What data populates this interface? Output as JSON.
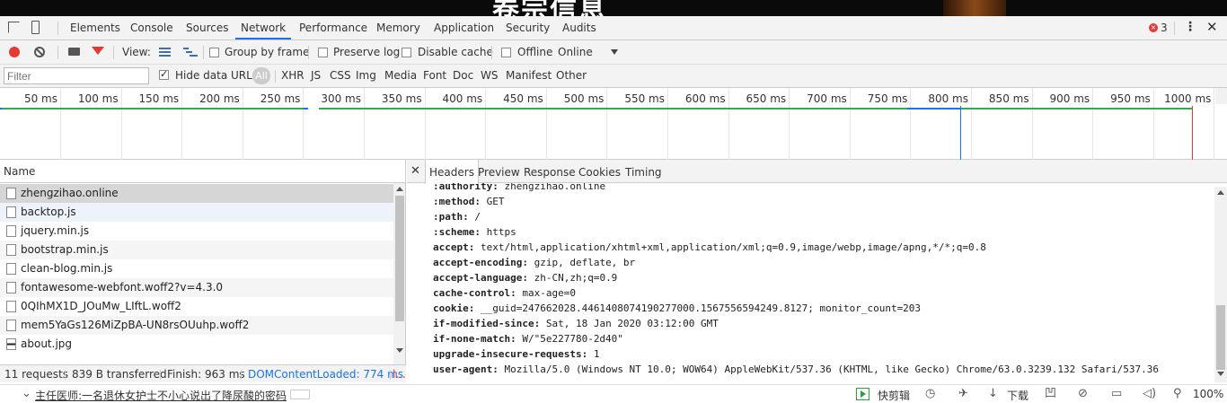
{
  "devtools": {
    "tabs": [
      "Elements",
      "Console",
      "Sources",
      "Network",
      "Performance",
      "Memory",
      "Application",
      "Security",
      "Audits"
    ],
    "active_tab": "Network",
    "error_count": "3"
  },
  "toolbar": {
    "view_label": "View:",
    "group_by_frame": "Group by frame",
    "preserve_log": "Preserve log",
    "disable_cache": "Disable cache",
    "offline": "Offline",
    "throttle": "Online"
  },
  "filterbar": {
    "filter_placeholder": "Filter",
    "hide_data_urls": "Hide data URLs",
    "types": [
      "All",
      "XHR",
      "JS",
      "CSS",
      "Img",
      "Media",
      "Font",
      "Doc",
      "WS",
      "Manifest",
      "Other"
    ]
  },
  "timeline": {
    "ticks": [
      "50 ms",
      "100 ms",
      "150 ms",
      "200 ms",
      "250 ms",
      "300 ms",
      "350 ms",
      "400 ms",
      "450 ms",
      "500 ms",
      "550 ms",
      "600 ms",
      "650 ms",
      "700 ms",
      "750 ms",
      "800 ms",
      "850 ms",
      "900 ms",
      "950 ms",
      "1000 ms"
    ],
    "colors": {
      "dom_content_loaded": "#1a73e8",
      "load": "#e53935",
      "waterfall": "#34a853"
    }
  },
  "requests": {
    "header": "Name",
    "items": [
      {
        "name": "zhengzihao.online",
        "type": "doc"
      },
      {
        "name": "backtop.js",
        "type": "doc"
      },
      {
        "name": "jquery.min.js",
        "type": "doc"
      },
      {
        "name": "bootstrap.min.js",
        "type": "doc"
      },
      {
        "name": "clean-blog.min.js",
        "type": "doc"
      },
      {
        "name": "fontawesome-webfont.woff2?v=4.3.0",
        "type": "doc"
      },
      {
        "name": "0QIhMX1D_JOuMw_LIftL.woff2",
        "type": "doc"
      },
      {
        "name": "mem5YaGs126MiZpBA-UN8rsOUuhp.woff2",
        "type": "doc"
      },
      {
        "name": "about.jpg",
        "type": "img"
      }
    ]
  },
  "status": {
    "requests": "11 requests",
    "transferred": "839 B transferred",
    "finish": "Finish: 963 ms",
    "dcl": "DOMContentLoaded: 774 ms",
    "load": "l..."
  },
  "details": {
    "tabs": [
      "Headers",
      "Preview",
      "Response",
      "Cookies",
      "Timing"
    ],
    "active_tab": "Headers",
    "headers": [
      {
        "key": ":authority:",
        "value": "zhengzihao.online"
      },
      {
        "key": ":method:",
        "value": "GET"
      },
      {
        "key": ":path:",
        "value": "/"
      },
      {
        "key": ":scheme:",
        "value": "https"
      },
      {
        "key": "accept:",
        "value": "text/html,application/xhtml+xml,application/xml;q=0.9,image/webp,image/apng,*/*;q=0.8"
      },
      {
        "key": "accept-encoding:",
        "value": "gzip, deflate, br"
      },
      {
        "key": "accept-language:",
        "value": "zh-CN,zh;q=0.9"
      },
      {
        "key": "cache-control:",
        "value": "max-age=0"
      },
      {
        "key": "cookie:",
        "value": "__guid=247662028.4461408074190277000.1567556594249.8127; monitor_count=203"
      },
      {
        "key": "if-modified-since:",
        "value": "Sat, 18 Jan 2020 03:12:00 GMT"
      },
      {
        "key": "if-none-match:",
        "value": "W/\"5e227780-2d40\""
      },
      {
        "key": "upgrade-insecure-requests:",
        "value": "1"
      },
      {
        "key": "user-agent:",
        "value": "Mozilla/5.0 (Windows NT 10.0; WOW64) AppleWebKit/537.36 (KHTML, like Gecko) Chrome/63.0.3239.132 Safari/537.36"
      }
    ]
  },
  "browser_bar": {
    "news": "主任医师:一名退休女护士不小心说出了降尿酸的密码",
    "cut": "快剪辑",
    "download": "下载",
    "zoom": "100%"
  }
}
